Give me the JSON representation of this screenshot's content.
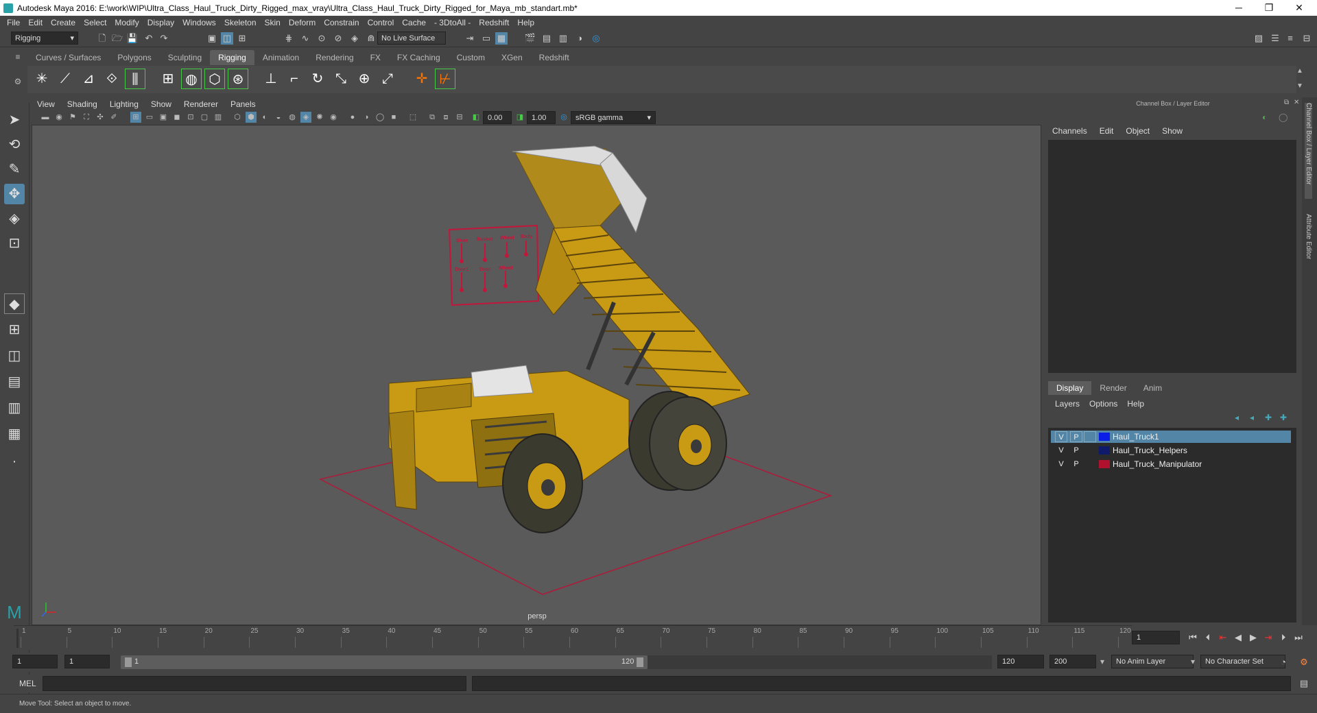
{
  "window": {
    "title": "Autodesk Maya 2016: E:\\work\\WIP\\Ultra_Class_Haul_Truck_Dirty_Rigged_max_vray\\Ultra_Class_Haul_Truck_Dirty_Rigged_for_Maya_mb_standart.mb*",
    "minimize": "─",
    "restore": "❐",
    "close": "✕"
  },
  "menubar": [
    "File",
    "Edit",
    "Create",
    "Select",
    "Modify",
    "Display",
    "Windows",
    "Skeleton",
    "Skin",
    "Deform",
    "Constrain",
    "Control",
    "Cache",
    "- 3DtoAll -",
    "Redshift",
    "Help"
  ],
  "statusline": {
    "menuset": "Rigging",
    "live_surface": "No Live Surface"
  },
  "shelf": {
    "tabs": [
      "Curves / Surfaces",
      "Polygons",
      "Sculpting",
      "Rigging",
      "Animation",
      "Rendering",
      "FX",
      "FX Caching",
      "Custom",
      "XGen",
      "Redshift"
    ],
    "active_tab": "Rigging"
  },
  "viewport": {
    "menu": [
      "View",
      "Shading",
      "Lighting",
      "Show",
      "Renderer",
      "Panels"
    ],
    "exposure": "0.00",
    "gamma": "1.00",
    "color_space": "sRGB gamma",
    "camera_label": "persp",
    "manipulator_labels": [
      "Steer",
      "Bucket",
      "Wheel",
      "Body",
      "Door1",
      "Door",
      "Wheel"
    ]
  },
  "channel_box": {
    "header": "Channel Box / Layer Editor",
    "menu": [
      "Channels",
      "Edit",
      "Object",
      "Show"
    ]
  },
  "layer_editor": {
    "tabs": [
      "Display",
      "Render",
      "Anim"
    ],
    "active_tab": "Display",
    "menu": [
      "Layers",
      "Options",
      "Help"
    ],
    "layers": [
      {
        "v": "V",
        "p": "P",
        "name": "Haul_Truck1",
        "color": "#0a1ee8",
        "selected": true
      },
      {
        "v": "V",
        "p": "P",
        "name": "Haul_Truck_Helpers",
        "color": "#101a6a",
        "selected": false
      },
      {
        "v": "V",
        "p": "P",
        "name": "Haul_Truck_Manipulator",
        "color": "#b0122e",
        "selected": false
      }
    ]
  },
  "side_tabs": [
    "Channel Box / Layer Editor",
    "Attribute Editor"
  ],
  "timeline": {
    "ticks": [
      "1",
      "5",
      "10",
      "15",
      "20",
      "25",
      "30",
      "35",
      "40",
      "45",
      "50",
      "55",
      "60",
      "65",
      "70",
      "75",
      "80",
      "85",
      "90",
      "95",
      "100",
      "105",
      "110",
      "115",
      "120"
    ],
    "current_frame": "1"
  },
  "range": {
    "start": "1",
    "start_inner": "1",
    "slider_start": "1",
    "slider_end": "120",
    "end_inner": "120",
    "end": "200",
    "anim_layer": "No Anim Layer",
    "char_set": "No Character Set"
  },
  "cmdline": {
    "label": "MEL"
  },
  "helpline": {
    "text": "Move Tool: Select an object to move."
  }
}
